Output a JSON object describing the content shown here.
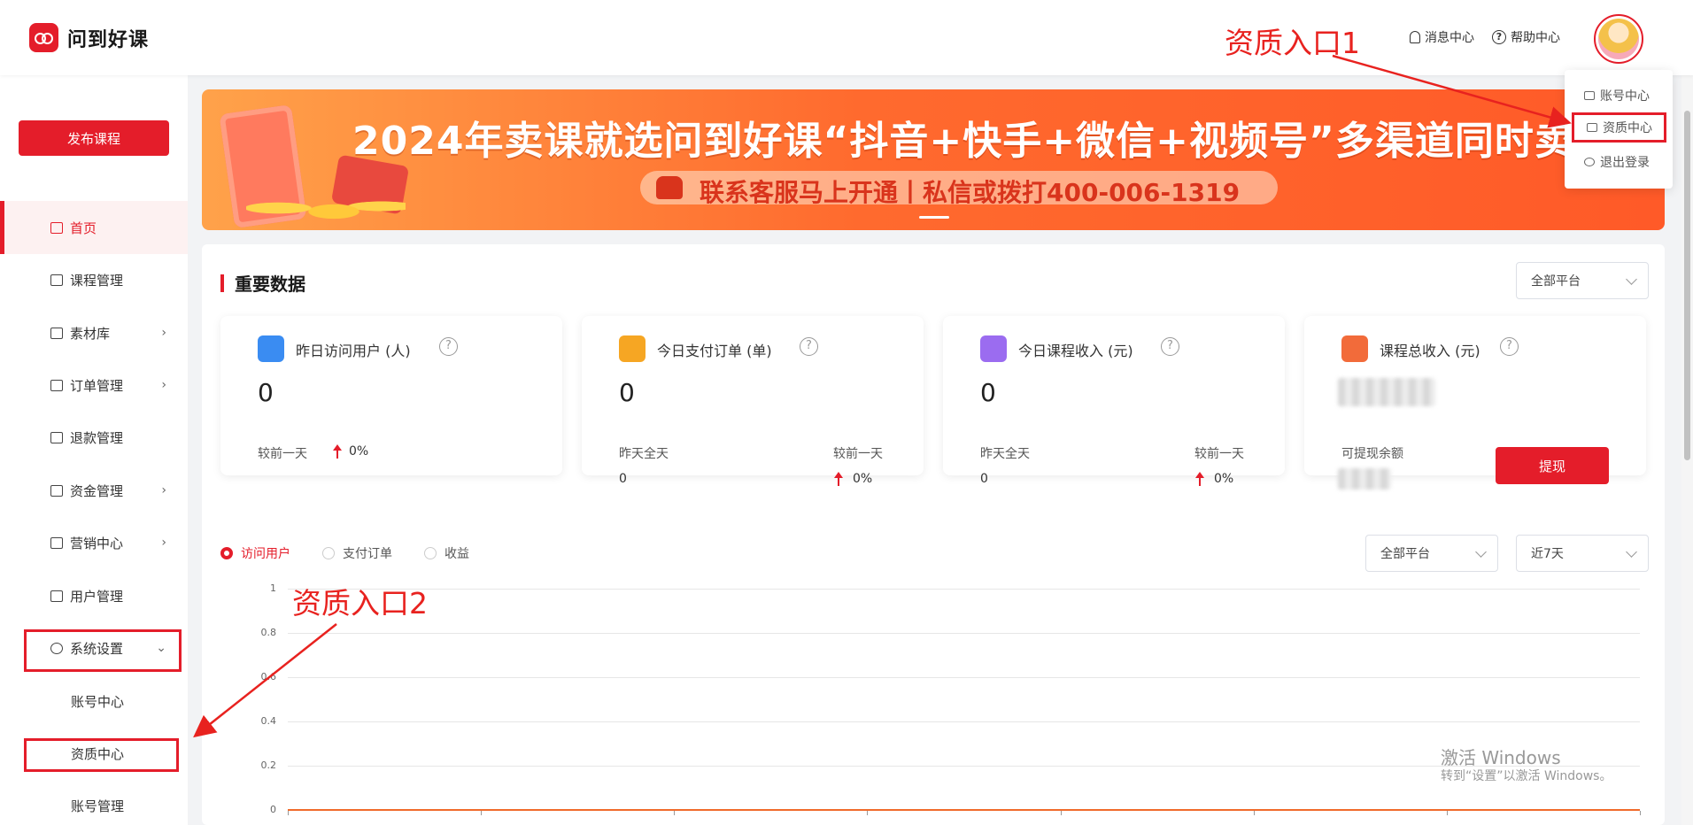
{
  "brand": {
    "name": "问到好课"
  },
  "header": {
    "message_center": "消息中心",
    "help_center": "帮助中心"
  },
  "user_menu": {
    "items": [
      "账号中心",
      "资质中心",
      "退出登录"
    ]
  },
  "annotations": {
    "entry1": "资质入口1",
    "entry2": "资质入口2"
  },
  "sidebar": {
    "publish_label": "发布课程",
    "items": [
      {
        "label": "首页",
        "icon": "home-icon",
        "active": true
      },
      {
        "label": "课程管理",
        "icon": "course-icon"
      },
      {
        "label": "素材库",
        "icon": "folder-icon",
        "chevron": "›"
      },
      {
        "label": "订单管理",
        "icon": "order-icon",
        "chevron": "›"
      },
      {
        "label": "退款管理",
        "icon": "refund-icon"
      },
      {
        "label": "资金管理",
        "icon": "wallet-icon",
        "chevron": "›"
      },
      {
        "label": "营销中心",
        "icon": "gift-icon",
        "chevron": "›"
      },
      {
        "label": "用户管理",
        "icon": "user-icon"
      },
      {
        "label": "系统设置",
        "icon": "gear-icon",
        "chevron": "⌄"
      }
    ],
    "sub_items": [
      "账号中心",
      "资质中心",
      "账号管理"
    ]
  },
  "banner": {
    "title": "2024年卖课就选问到好课“抖音+快手+微信+视频号”多渠道同时卖",
    "subtitle": "联系客服马上开通丨私信或拨打400-006-1319"
  },
  "dashboard": {
    "title": "重要数据",
    "platform_select": "全部平台",
    "cards": [
      {
        "title": "昨日访问用户 (人)",
        "value": "0",
        "compare_label": "较前一天",
        "compare_value": "0%",
        "color": "#3a8cf2"
      },
      {
        "title": "今日支付订单 (单)",
        "value": "0",
        "yesterday_label": "昨天全天",
        "yesterday_value": "0",
        "compare_label": "较前一天",
        "compare_value": "0%",
        "color": "#f6a623"
      },
      {
        "title": "今日课程收入 (元)",
        "value": "0",
        "yesterday_label": "昨天全天",
        "yesterday_value": "0",
        "compare_label": "较前一天",
        "compare_value": "0%",
        "color": "#9b6cf0"
      },
      {
        "title": "课程总收入 (元)",
        "withdrawable_label": "可提现余额",
        "withdraw_button": "提现",
        "color": "#f26b3a"
      }
    ],
    "question_mark": "?"
  },
  "chart_controls": {
    "radios": [
      {
        "label": "访问用户",
        "selected": true
      },
      {
        "label": "支付订单",
        "selected": false
      },
      {
        "label": "收益",
        "selected": false
      }
    ],
    "platform_select": "全部平台",
    "range_select": "近7天"
  },
  "chart_data": {
    "type": "line",
    "series": [
      {
        "values": [
          0,
          0,
          0,
          0,
          0,
          0,
          0,
          0
        ]
      }
    ],
    "yticks": [
      "1",
      "0.8",
      "0.6",
      "0.4",
      "0.2",
      "0"
    ],
    "ylim": [
      0,
      1
    ],
    "grid": true,
    "color": "#f06b2b"
  },
  "watermark": {
    "line1": "激活 Windows",
    "line2": "转到“设置”以激活 Windows。"
  },
  "colors": {
    "accent": "#e41d2a",
    "annotation": "#e8221f"
  }
}
